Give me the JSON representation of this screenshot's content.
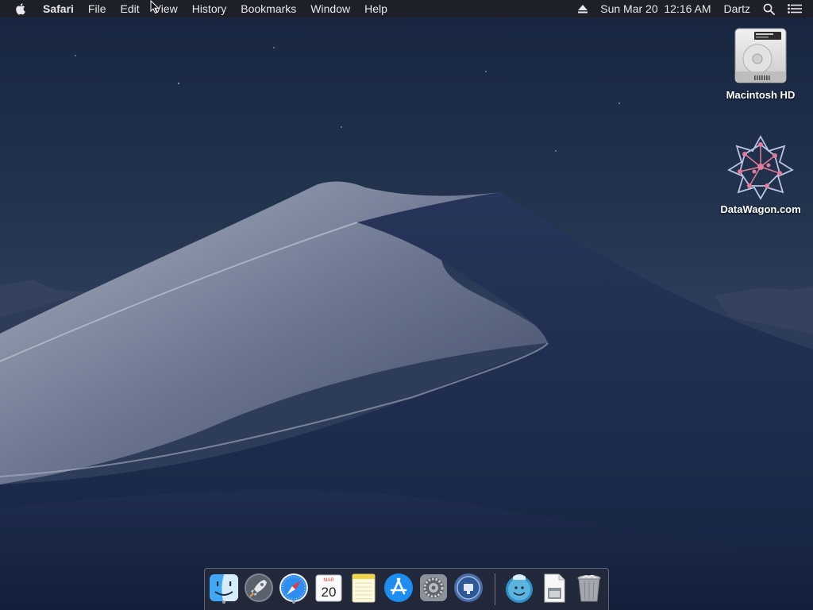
{
  "menubar": {
    "apple_icon": "apple-logo-icon",
    "app_name": "Safari",
    "menus": [
      "File",
      "Edit",
      "View",
      "History",
      "Bookmarks",
      "Window",
      "Help"
    ],
    "eject_icon": "eject-icon",
    "clock": "Sun Mar 20  12:16 AM",
    "user": "Dartz",
    "spotlight_icon": "search-icon",
    "notification_icon": "list-icon"
  },
  "desktop": {
    "icons": [
      {
        "label": "Macintosh HD",
        "icon": "hard-drive-icon"
      },
      {
        "label": "DataWagon.com",
        "icon": "datawagon-logo-icon"
      }
    ]
  },
  "dock": {
    "items": [
      {
        "name": "Finder",
        "icon": "finder-icon",
        "running": true
      },
      {
        "name": "Launchpad",
        "icon": "launchpad-icon",
        "running": false
      },
      {
        "name": "Safari",
        "icon": "safari-icon",
        "running": true
      },
      {
        "name": "Calendar",
        "icon": "calendar-icon",
        "running": false,
        "month": "MAR",
        "day": "20"
      },
      {
        "name": "Notes",
        "icon": "notes-icon",
        "running": false
      },
      {
        "name": "App Store",
        "icon": "app-store-icon",
        "running": false
      },
      {
        "name": "System Preferences",
        "icon": "system-preferences-icon",
        "running": false
      },
      {
        "name": "Screen Sharing",
        "icon": "screen-sharing-icon",
        "running": false
      },
      {
        "name": "Downloads",
        "icon": "downloads-icon",
        "running": false
      },
      {
        "name": "Document",
        "icon": "document-icon",
        "running": false
      },
      {
        "name": "Trash",
        "icon": "trash-icon",
        "running": false
      }
    ]
  },
  "colors": {
    "menubar_bg": "#1e2026",
    "menubar_text": "#e9e9ec",
    "sky_top": "#1c2a45",
    "dune_light": "#9aa3b3"
  }
}
